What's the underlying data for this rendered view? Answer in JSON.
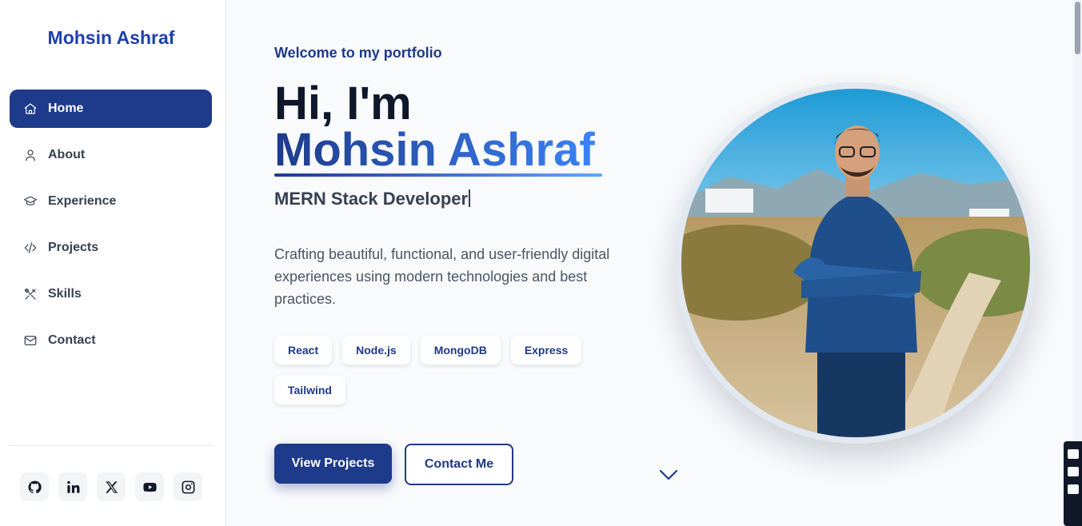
{
  "sidebar": {
    "brand": "Mohsin Ashraf",
    "nav": [
      {
        "label": "Home",
        "icon": "home-icon",
        "active": true
      },
      {
        "label": "About",
        "icon": "user-icon"
      },
      {
        "label": "Experience",
        "icon": "graduation-cap-icon"
      },
      {
        "label": "Projects",
        "icon": "code-icon"
      },
      {
        "label": "Skills",
        "icon": "tools-icon"
      },
      {
        "label": "Contact",
        "icon": "mail-icon"
      }
    ],
    "socials": [
      "github-icon",
      "linkedin-icon",
      "x-icon",
      "youtube-icon",
      "instagram-icon"
    ]
  },
  "hero": {
    "welcome": "Welcome to my portfolio",
    "greeting": "Hi, I'm",
    "name": "Mohsin Ashraf",
    "role": "MERN Stack Developer",
    "description": "Crafting beautiful, functional, and user-friendly digital experiences using modern technologies and best practices.",
    "tags": [
      "React",
      "Node.js",
      "MongoDB",
      "Express",
      "Tailwind"
    ],
    "primary_button": "View Projects",
    "secondary_button": "Contact Me"
  },
  "colors": {
    "accent": "#1e3a8a",
    "accent_light": "#3b82f6",
    "text_dark": "#0f172a",
    "background": "#f8fafc"
  }
}
